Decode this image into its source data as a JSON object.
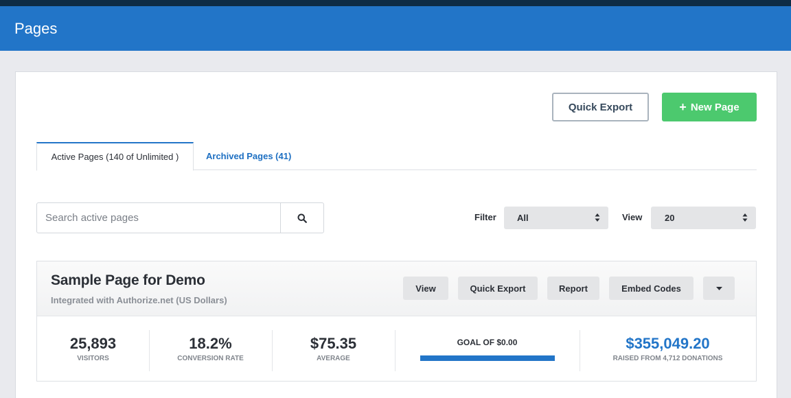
{
  "header": {
    "title": "Pages"
  },
  "actions": {
    "quick_export": "Quick Export",
    "new_page_icon": "+",
    "new_page": "New Page"
  },
  "tabs": [
    {
      "label": "Active Pages (140 of Unlimited )",
      "active": true
    },
    {
      "label": "Archived Pages (41)",
      "active": false
    }
  ],
  "search": {
    "placeholder": "Search active pages",
    "value": "",
    "icon": "search-icon"
  },
  "filter": {
    "label": "Filter",
    "value": "All"
  },
  "view": {
    "label": "View",
    "value": "20"
  },
  "page_card": {
    "title": "Sample Page for Demo",
    "subtitle": "Integrated with Authorize.net (US Dollars)",
    "buttons": {
      "view": "View",
      "quick_export": "Quick Export",
      "report": "Report",
      "embed_codes": "Embed Codes",
      "more_icon": "caret-down-icon"
    },
    "stats": {
      "visitors": {
        "value": "25,893",
        "label": "VISITORS"
      },
      "conversion": {
        "value": "18.2%",
        "label": "CONVERSION RATE"
      },
      "average": {
        "value": "$75.35",
        "label": "AVERAGE"
      },
      "goal": {
        "label": "GOAL OF $0.00",
        "progress": 1.0
      },
      "raised": {
        "value": "$355,049.20",
        "label": "RAISED FROM 4,712 DONATIONS"
      }
    }
  },
  "colors": {
    "header_blue": "#2275c8",
    "top_strip": "#0e2c45",
    "new_page_green": "#4cc96e",
    "raised_blue": "#2275c8"
  }
}
